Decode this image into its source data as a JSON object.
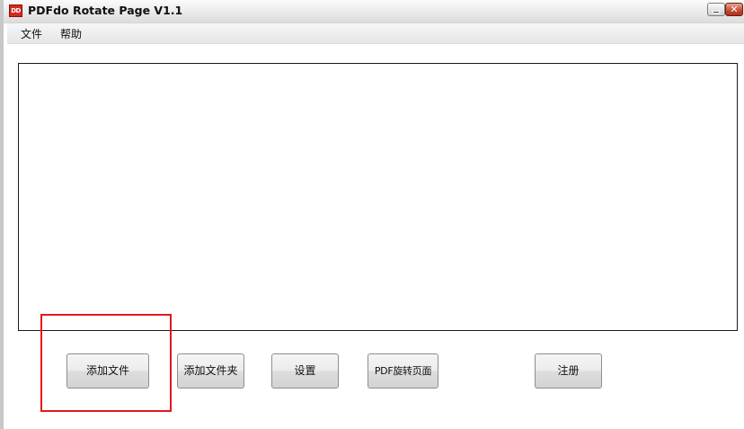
{
  "window": {
    "title": "PDFdo Rotate Page V1.1",
    "icon_label": "DD",
    "icon_name": "pdfdo-app-icon",
    "minimize_icon": "minimize-icon",
    "close_icon": "close-icon",
    "close_glyph": "✕"
  },
  "menu": {
    "file": "文件",
    "help": "帮助"
  },
  "buttons": {
    "add_file": "添加文件",
    "add_folder": "添加文件夹",
    "settings": "设置",
    "rotate_pdf": "PDF旋转页面",
    "register": "注册"
  },
  "colors": {
    "highlight": "#e3191b",
    "close_button": "#c24a32",
    "app_icon": "#d22b1f"
  }
}
